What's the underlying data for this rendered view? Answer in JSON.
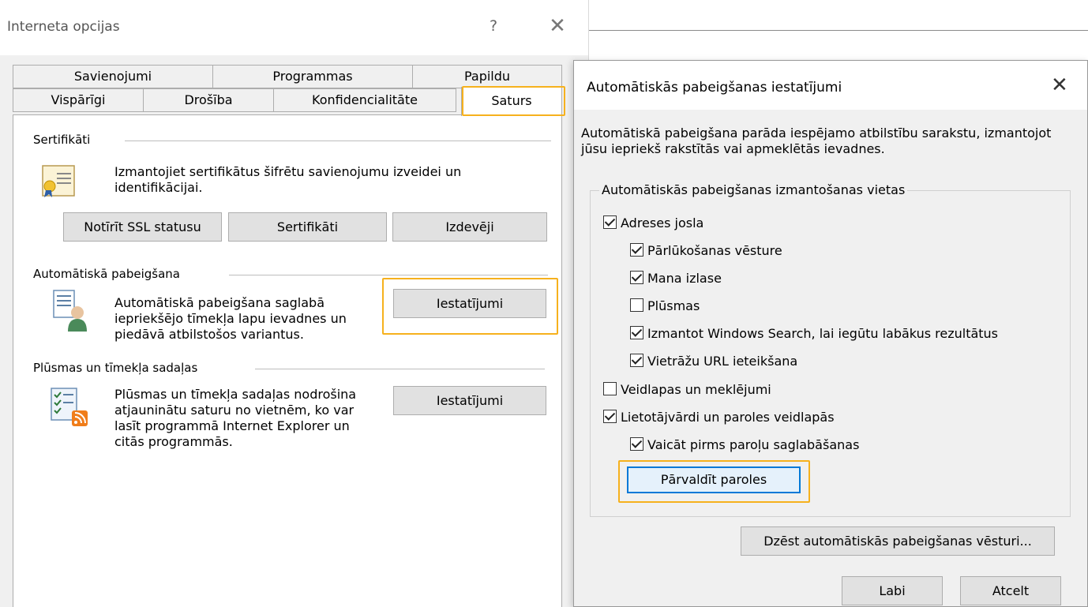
{
  "main_window": {
    "title": "Interneta opcijas",
    "help_label": "?",
    "close_label": "✕",
    "tabs_row1": [
      "Savienojumi",
      "Programmas",
      "Papildu"
    ],
    "tabs_row2": [
      "Vispārīgi",
      "Drošība",
      "Konfidencialitāte",
      "Saturs"
    ],
    "active_tab": "Saturs",
    "certificates": {
      "heading": "Sertifikāti",
      "description": "Izmantojiet sertifikātus šifrētu savienojumu izveidei un identifikācijai.",
      "buttons": [
        "Notīrīt SSL statusu",
        "Sertifikāti",
        "Izdevēji"
      ]
    },
    "autocomplete": {
      "heading": "Automātiskā pabeigšana",
      "description": "Automātiskā pabeigšana saglabā iepriekšējo tīmekļa lapu ievadnes un piedāvā atbilstošos variantus.",
      "settings_button": "Iestatījumi"
    },
    "feeds": {
      "heading": "Plūsmas un tīmekļa sadaļas",
      "description": "Plūsmas un tīmekļa sadaļas nodrošina atjauninātu saturu no vietnēm, ko var lasīt programmā Internet Explorer un citās programmās.",
      "settings_button": "Iestatījumi"
    }
  },
  "dialog": {
    "title": "Automātiskās pabeigšanas iestatījumi",
    "close_label": "✕",
    "description": "Automātiskā pabeigšana parāda iespējamo atbilstību sarakstu, izmantojot jūsu iepriekš rakstītās vai apmeklētās ievadnes.",
    "group_label": "Automātiskās pabeigšanas izmantošanas vietas",
    "checkboxes": [
      {
        "label": "Adreses josla",
        "checked": true
      },
      {
        "label": "Pārlūkošanas vēsture",
        "checked": true
      },
      {
        "label": "Mana izlase",
        "checked": true
      },
      {
        "label": "Plūsmas",
        "checked": false
      },
      {
        "label": "Izmantot Windows Search, lai iegūtu labākus rezultātus",
        "checked": true
      },
      {
        "label": "Vietrāžu URL ieteikšana",
        "checked": true
      },
      {
        "label": "Veidlapas un meklējumi",
        "checked": false
      },
      {
        "label": "Lietotājvārdi un paroles veidlapās",
        "checked": true
      },
      {
        "label": "Vaicāt pirms paroļu saglabāšanas",
        "checked": true
      }
    ],
    "manage_passwords_button": "Pārvaldīt paroles",
    "delete_history_button": "Dzēst automātiskās pabeigšanas vēsturi...",
    "ok_button": "Labi",
    "cancel_button": "Atcelt"
  },
  "colors": {
    "highlight": "#f6b11d",
    "focus_blue": "#0078d7",
    "button_face": "#e1e1e1",
    "dialog_bg": "#f0f0f0"
  }
}
